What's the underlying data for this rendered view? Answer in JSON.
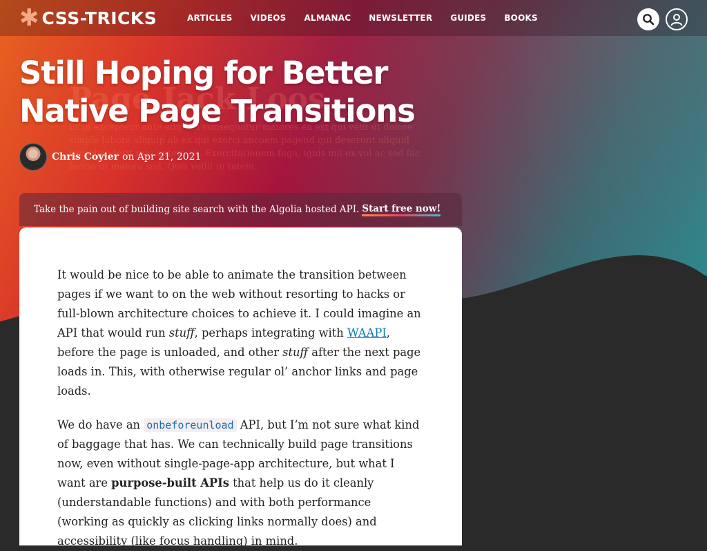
{
  "nav": {
    "logo_text": "CSS-TRICKS",
    "links": [
      "ARTICLES",
      "VIDEOS",
      "ALMANAC",
      "NEWSLETTER",
      "GUIDES",
      "BOOKS"
    ],
    "search_icon": "search-icon",
    "user_icon": "user-icon"
  },
  "article": {
    "title": "Still Hoping for Better Native Page Transitions",
    "author": "Chris Coyier",
    "date": "on Apr 21, 2021"
  },
  "sponsor": {
    "text": "Take the pain out of building site search with the Algolia hosted API.",
    "cta": "Start free now!"
  },
  "body": {
    "p1": [
      "It would be nice to be able to animate the transition between pages if we want to on the web without resorting to hacks or full-blown architecture choices to achieve it. I could imagine an API that would run ",
      "stuff",
      ", perhaps integrating with ",
      "WAAPI",
      ", before the page is unloaded, and other ",
      "stuff",
      " after the next page loads in. This, with otherwise regular ol’ anchor links and page loads."
    ],
    "p2": [
      "We do have an ",
      "onbeforeunload",
      " API, but I’m not sure what kind of baggage that has. We can technically build page transitions now, even without single-page-app architecture, but what I want are ",
      "purpose-built APIs",
      " that help us do it cleanly (understandable functions) and with both performance (working as quickly as clicking links normally does) and accessibility (like focus handling) in mind."
    ]
  },
  "colors": {
    "hero_start": "#e8641f",
    "hero_mid": "#a6123a",
    "hero_end": "#2b8e94",
    "link": "#0f7bb5",
    "background": "#2a2a2a"
  }
}
